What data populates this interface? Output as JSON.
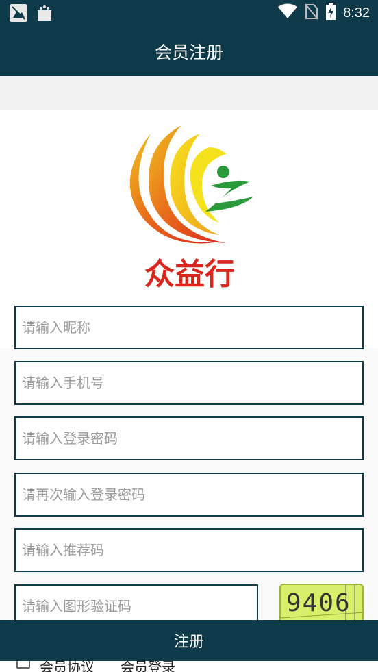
{
  "status_bar": {
    "time": "8:32",
    "icons": [
      "image-notification-icon",
      "bag-notification-icon",
      "wifi-icon",
      "no-sim-icon",
      "battery-charging-icon"
    ]
  },
  "header": {
    "title": "会员注册"
  },
  "logo": {
    "text": "众益行"
  },
  "form": {
    "nickname_placeholder": "请输入昵称",
    "phone_placeholder": "请输入手机号",
    "password_placeholder": "请输入登录密码",
    "password_confirm_placeholder": "请再次输入登录密码",
    "referral_placeholder": "请输入推荐码",
    "captcha_placeholder": "请输入图形验证码",
    "captcha_image_text": "9406"
  },
  "bottom_links": {
    "agreement": "会员协议",
    "login": "会员登录"
  },
  "submit": {
    "label": "注册"
  },
  "colors": {
    "primary": "#0e3a4a",
    "logo_red": "#d9251c",
    "logo_green": "#2a9a3a",
    "captcha_bg": "#d7ef6a"
  }
}
